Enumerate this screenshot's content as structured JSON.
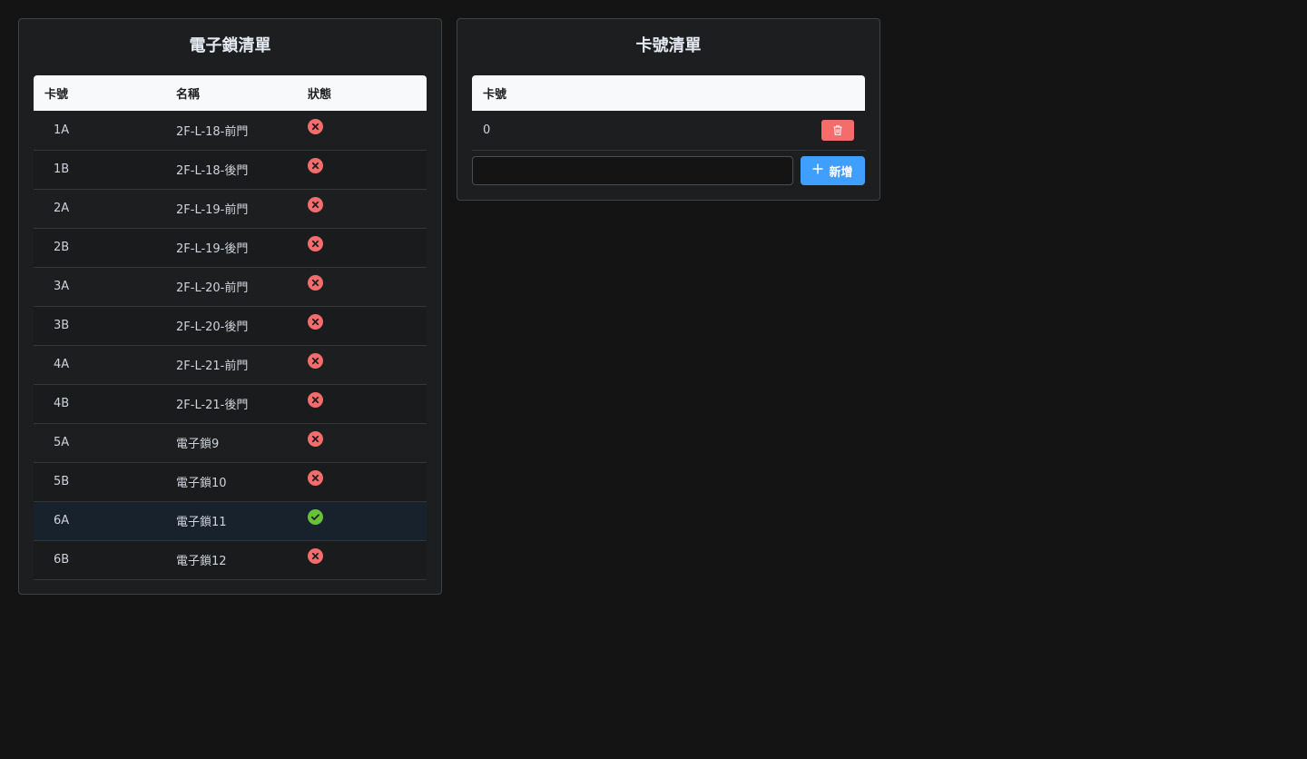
{
  "lock_panel": {
    "title": "電子鎖清單",
    "headers": [
      "卡號",
      "名稱",
      "狀態"
    ],
    "rows": [
      {
        "id": "1A",
        "name": "2F-L-18-前門",
        "status": "error"
      },
      {
        "id": "1B",
        "name": "2F-L-18-後門",
        "status": "error"
      },
      {
        "id": "2A",
        "name": "2F-L-19-前門",
        "status": "error"
      },
      {
        "id": "2B",
        "name": "2F-L-19-後門",
        "status": "error"
      },
      {
        "id": "3A",
        "name": "2F-L-20-前門",
        "status": "error"
      },
      {
        "id": "3B",
        "name": "2F-L-20-後門",
        "status": "error"
      },
      {
        "id": "4A",
        "name": "2F-L-21-前門",
        "status": "error"
      },
      {
        "id": "4B",
        "name": "2F-L-21-後門",
        "status": "error"
      },
      {
        "id": "5A",
        "name": "電子鎖9",
        "status": "error"
      },
      {
        "id": "5B",
        "name": "電子鎖10",
        "status": "error"
      },
      {
        "id": "6A",
        "name": "電子鎖11",
        "status": "success"
      },
      {
        "id": "6B",
        "name": "電子鎖12",
        "status": "error"
      }
    ]
  },
  "card_panel": {
    "title": "卡號清單",
    "header": "卡號",
    "rows": [
      {
        "card": "0",
        "delete_icon": "trash-icon"
      }
    ],
    "input": {
      "value": "",
      "placeholder": ""
    },
    "add_button": {
      "label": "新增",
      "icon": "plus-icon"
    }
  },
  "colors": {
    "error": "#f56c6c",
    "success": "#67c23a",
    "primary": "#409eff",
    "background": "#141414",
    "panel": "#1d1e1f"
  }
}
